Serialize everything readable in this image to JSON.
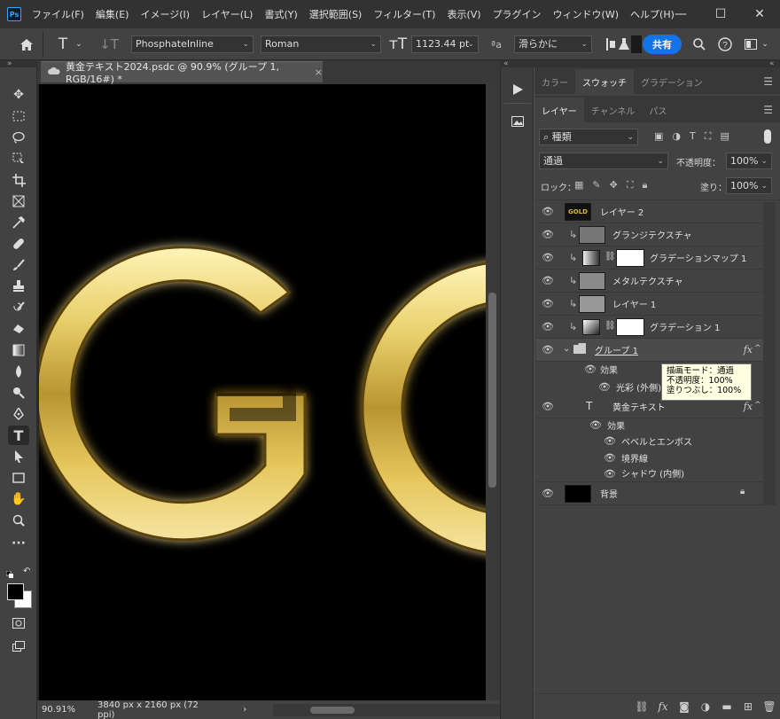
{
  "app": {
    "logo": "Ps",
    "menus": [
      "ファイル(F)",
      "編集(E)",
      "イメージ(I)",
      "レイヤー(L)",
      "書式(Y)",
      "選択範囲(S)",
      "フィルター(T)",
      "表示(V)",
      "プラグイン",
      "ウィンドウ(W)",
      "ヘルプ(H)"
    ],
    "window_controls": [
      "—",
      "☐",
      "✕"
    ]
  },
  "options": {
    "font_family": "PhosphateInline",
    "font_style": "Roman",
    "font_size": "1123.44 pt",
    "antialias": "滑らかに",
    "share_label": "共有"
  },
  "document": {
    "tab_title": "黄金テキスト2024.psdc @ 90.9% (グループ 1, RGB/16#) *",
    "close": "×",
    "canvas_text": "GO",
    "zoom": "90.91%",
    "dimensions": "3840 px x 2160 px (72 ppi)",
    "status_arrow": "›"
  },
  "panels": {
    "top_tabs": [
      "カラー",
      "スウォッチ",
      "グラデーション"
    ],
    "top_active": 1,
    "layer_tabs": [
      "レイヤー",
      "チャンネル",
      "パス"
    ],
    "layer_active": 0,
    "filter_kind": "種類",
    "blend_mode": "通過",
    "opacity_label": "不透明度：",
    "opacity_value": "100%",
    "lock_label": "ロック：",
    "fill_label": "塗り：",
    "fill_value": "100%"
  },
  "layers": [
    {
      "name": "レイヤー 2",
      "kind": "gold"
    },
    {
      "name": "グランジテクスチャ",
      "kind": "texture",
      "clip": true
    },
    {
      "name": "グラデーションマップ 1",
      "kind": "adjust",
      "clip": true
    },
    {
      "name": "メタルテクスチャ",
      "kind": "texture",
      "clip": true
    },
    {
      "name": "レイヤー 1",
      "kind": "texture",
      "clip": true
    },
    {
      "name": "グラデーション 1",
      "kind": "gradient",
      "clip": true
    },
    {
      "name": "グループ 1",
      "kind": "group"
    },
    {
      "name": "効果",
      "kind": "effects-header"
    },
    {
      "name": "光彩 (外側)",
      "kind": "effect"
    },
    {
      "name": "黄金テキスト",
      "kind": "text"
    },
    {
      "name": "効果",
      "kind": "effects-header"
    },
    {
      "name": "ベベルとエンボス",
      "kind": "effect"
    },
    {
      "name": "境界線",
      "kind": "effect"
    },
    {
      "name": "シャドウ (内側)",
      "kind": "effect"
    },
    {
      "name": "背景",
      "kind": "background"
    }
  ],
  "fx_label": "fx",
  "tooltip": {
    "line1": "描画モード：通過",
    "line2": "不透明度：100%",
    "line3": "塗りつぶし：100%"
  },
  "colors": {
    "accent": "#1473e6",
    "gold_light": "#f3e7a0",
    "gold_dark": "#7a5a14"
  }
}
